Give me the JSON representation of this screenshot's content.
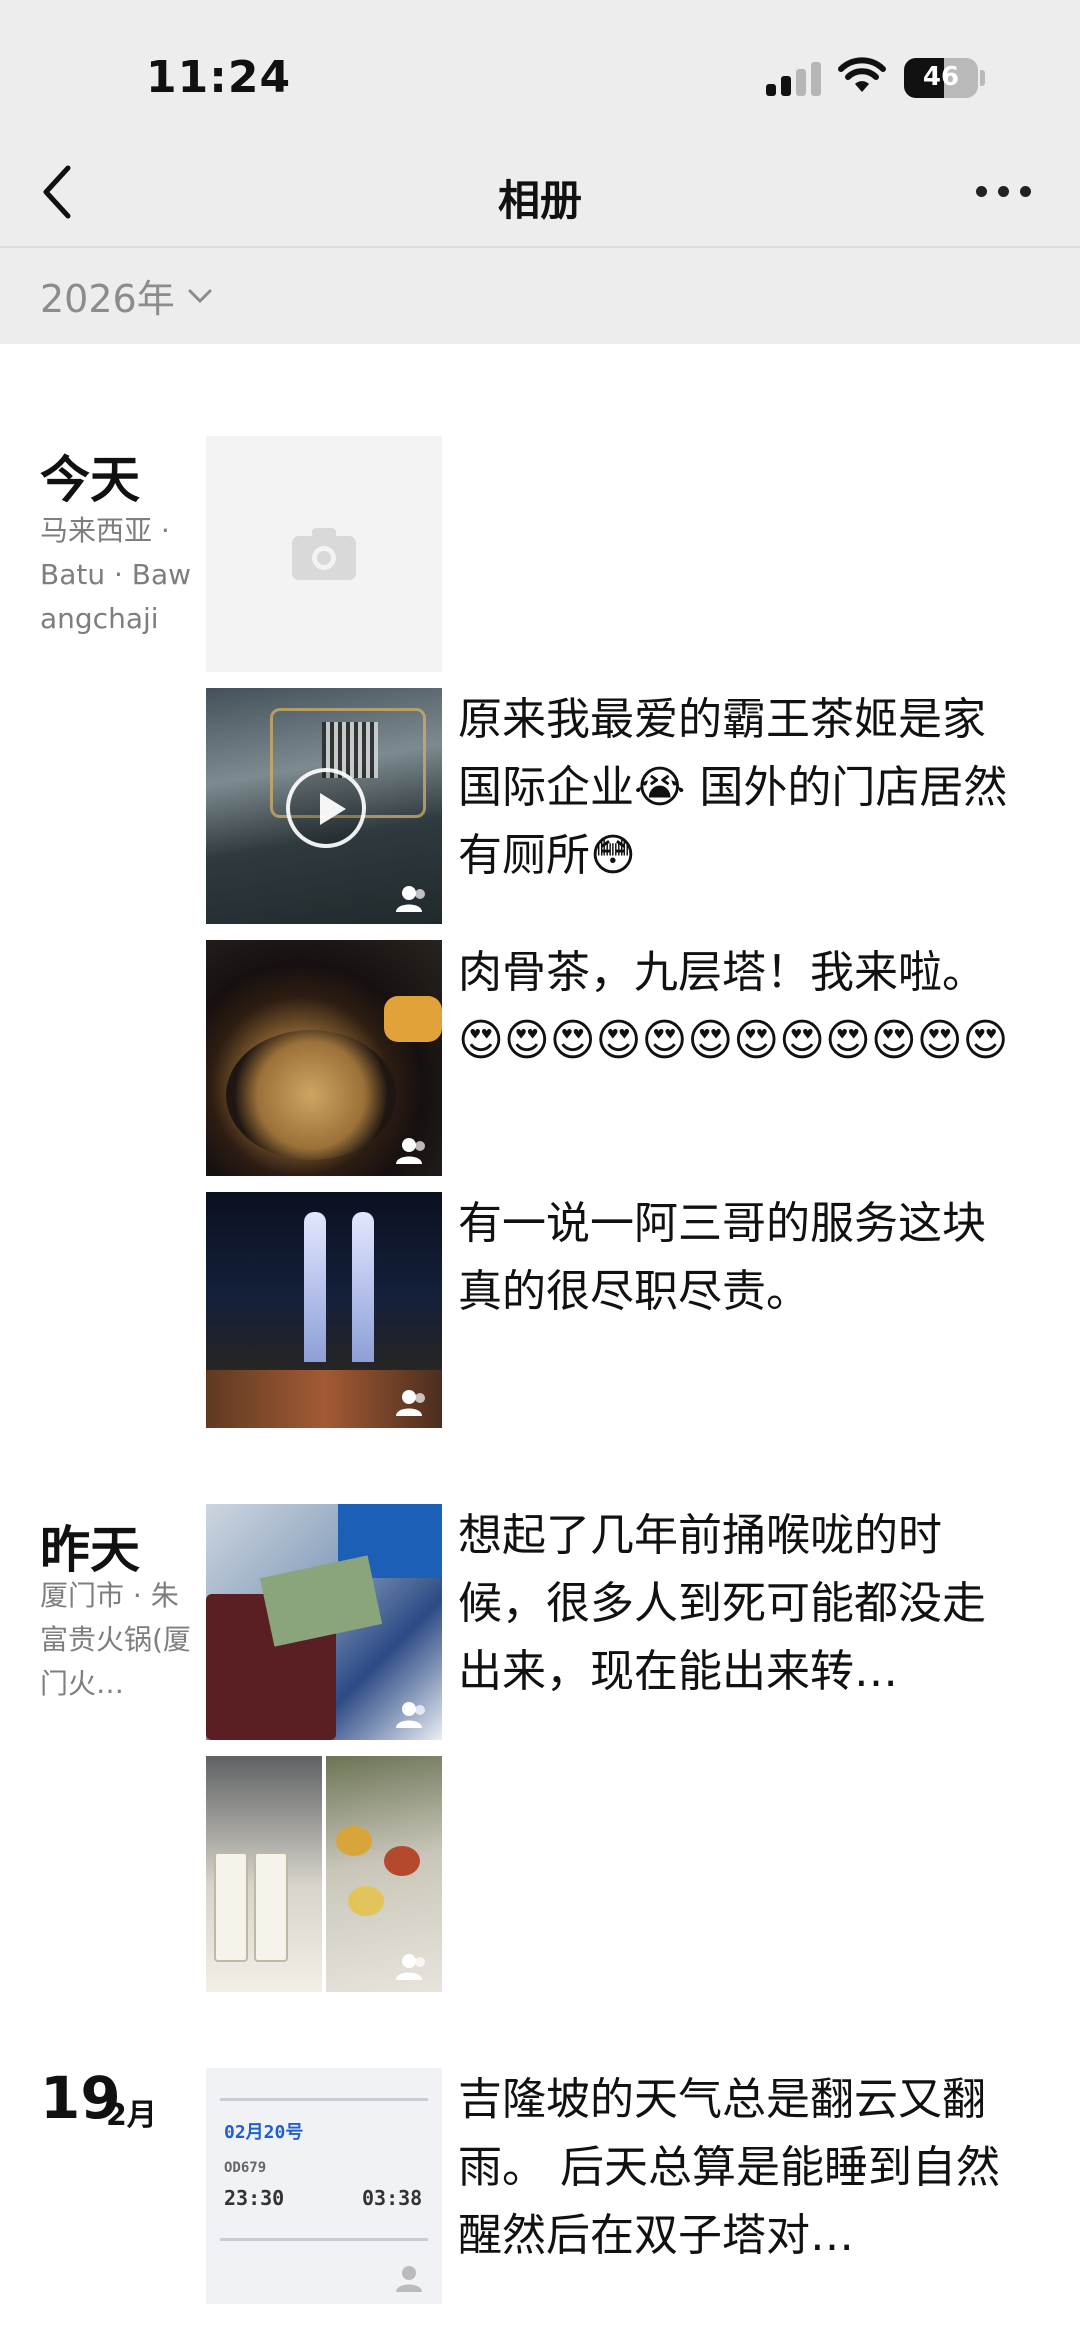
{
  "status_bar": {
    "time": "11:24",
    "battery": "46"
  },
  "nav": {
    "title": "相册"
  },
  "year_selector": {
    "label": "2026年"
  },
  "groups": [
    {
      "date": "今天",
      "location": "马来西亚 · Batu · Bawangchaji",
      "posts": [
        {
          "caption": "原来我最爱的霸王茶姬是家国际企业😭 国外的门店居然有厕所😳"
        },
        {
          "caption": "肉骨茶，九层塔！我来啦。😍😍😍😍😍😍😍😍😍😍😍😍"
        },
        {
          "caption": "有一说一阿三哥的服务这块 真的很尽职尽责。"
        }
      ]
    },
    {
      "date": "昨天",
      "location": "厦门市 · 朱富贵火锅(厦门火…",
      "posts": [
        {
          "caption": "想起了几年前捅喉咙的时候，很多人到死可能都没走出来，现在能出来转…"
        }
      ]
    },
    {
      "day": "19",
      "month": "2月",
      "posts": [
        {
          "caption": "吉隆坡的天气总是翻云又翻雨。 后天总算是能睡到自然醒然后在双子塔对…"
        }
      ]
    }
  ],
  "ticket_preview": {
    "date": "02月20号",
    "depart": "23:30",
    "arrive": "03:38",
    "flight": "OD679"
  },
  "colors": {
    "nav_bg": "#ededed",
    "muted_text": "#7e7e7e"
  }
}
